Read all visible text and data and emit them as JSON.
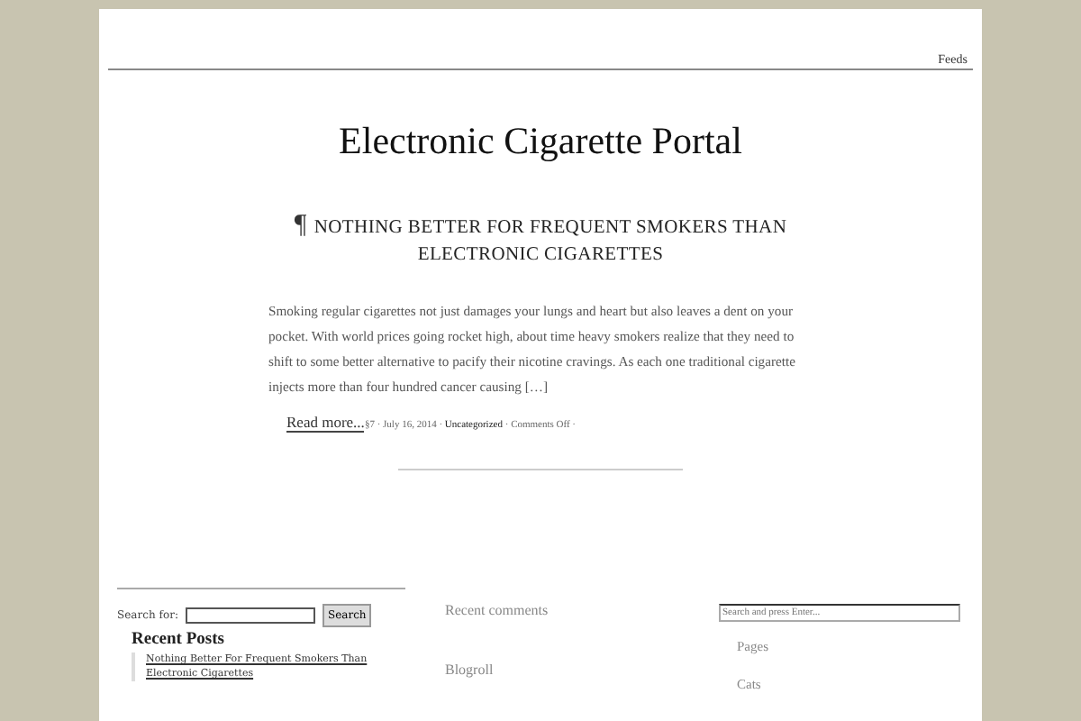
{
  "header": {
    "feeds_link": "Feeds",
    "site_title": "Electronic Cigarette Portal"
  },
  "post": {
    "mark": "¶",
    "title": "NOTHING BETTER FOR FREQUENT SMOKERS THAN ELECTRONIC CIGARETTES",
    "excerpt": "Smoking regular cigarettes not just damages your lungs and heart but also leaves a dent on your pocket. With world prices going rocket high, about time heavy smokers realize that they need to shift to some better alternative to pacify their nicotine cravings. As each one traditional cigarette injects more than four hundred cancer causing […]",
    "read_more": "Read more...",
    "meta": {
      "before": "§7 · July 16, 2014 · ",
      "category": "Uncategorized",
      "after": " · Comments Off ·"
    }
  },
  "sidebar_left": {
    "search_label": "Search for:",
    "search_button": "Search",
    "recent_posts_title": "Recent Posts",
    "recent_posts": [
      "Nothing Better For Frequent Smokers Than Electronic Cigarettes"
    ]
  },
  "sidebar_middle": {
    "headings": [
      "Recent comments",
      "Blogroll"
    ]
  },
  "sidebar_right": {
    "search_placeholder": "Search and press Enter...",
    "headings": [
      "Pages",
      "Cats"
    ]
  }
}
